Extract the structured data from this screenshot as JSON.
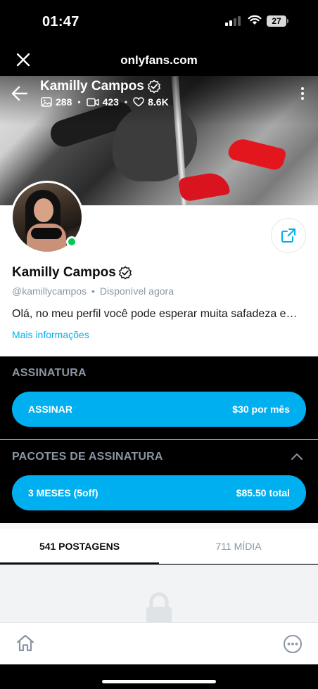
{
  "statusbar": {
    "time": "01:47",
    "battery": "27"
  },
  "browser": {
    "url": "onlyfans.com"
  },
  "cover": {
    "name": "Kamilly Campos",
    "stats": {
      "photos": "288",
      "videos": "423",
      "likes": "8.6K"
    }
  },
  "profile": {
    "name": "Kamilly Campos",
    "handle": "@kamillycampos",
    "availability": "Disponível agora",
    "bio": "Olá, no meu perfil você pode esperar muita safadeza e…",
    "more_info": "Mais informações",
    "online": true
  },
  "subscription": {
    "title": "ASSINATURA",
    "button_label": "ASSINAR",
    "price": "$30 por mês"
  },
  "bundles": {
    "title": "PACOTES DE ASSINATURA",
    "items": [
      {
        "label": "3 MESES (5off)",
        "price": "$85.50 total"
      }
    ]
  },
  "tabs": [
    {
      "label": "541 POSTAGENS",
      "active": true
    },
    {
      "label": "711 MÍDIA",
      "active": false
    }
  ],
  "colors": {
    "accent": "#00aff0",
    "online": "#00c853",
    "muted": "#8a96a3"
  }
}
